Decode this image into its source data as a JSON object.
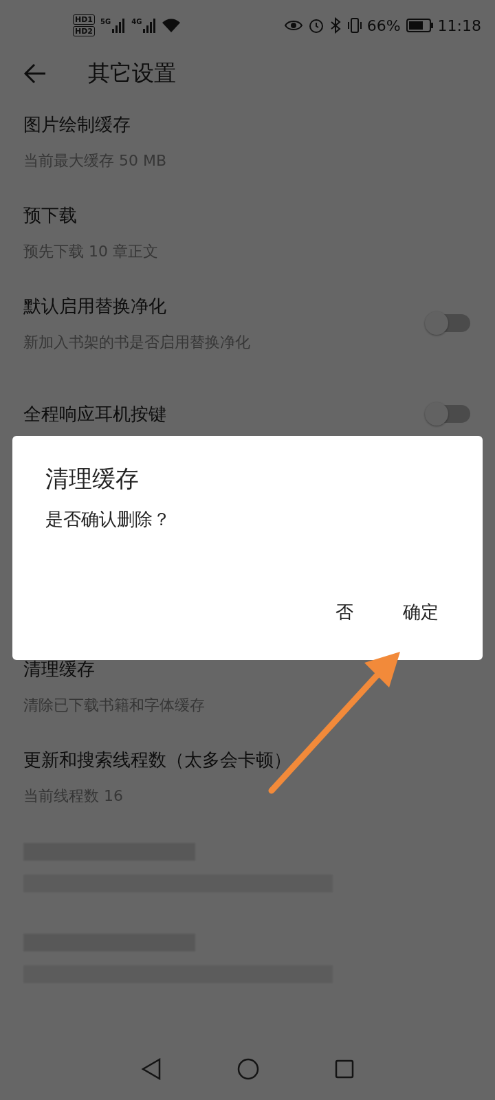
{
  "status_bar": {
    "sims": [
      {
        "label": "HD",
        "index": "1"
      },
      {
        "label": "HD",
        "index": "2"
      }
    ],
    "networks": [
      "5G",
      "4G"
    ],
    "battery": "66%",
    "time": "11:18"
  },
  "header": {
    "title": "其它设置"
  },
  "settings": [
    {
      "kind": "text",
      "title": "图片绘制缓存",
      "subtitle": "当前最大缓存 50 MB"
    },
    {
      "kind": "text",
      "title": "预下载",
      "subtitle": "预先下载 10 章正文"
    },
    {
      "kind": "switch",
      "title": "默认启用替换净化",
      "subtitle": "新加入书架的书是否启用替换净化",
      "on": false
    },
    {
      "kind": "switch",
      "title": "全程响应耳机按键",
      "on": false
    },
    {
      "kind": "hidden"
    },
    {
      "kind": "hidden"
    },
    {
      "kind": "text",
      "title": "清理缓存",
      "subtitle": "清除已下载书籍和字体缓存"
    },
    {
      "kind": "text",
      "title": "更新和搜索线程数（太多会卡顿）",
      "subtitle": "当前线程数 16"
    },
    {
      "kind": "redacted"
    },
    {
      "kind": "redacted"
    }
  ],
  "dialog": {
    "title": "清理缓存",
    "message": "是否确认删除？",
    "buttons": [
      "否",
      "确定"
    ]
  }
}
